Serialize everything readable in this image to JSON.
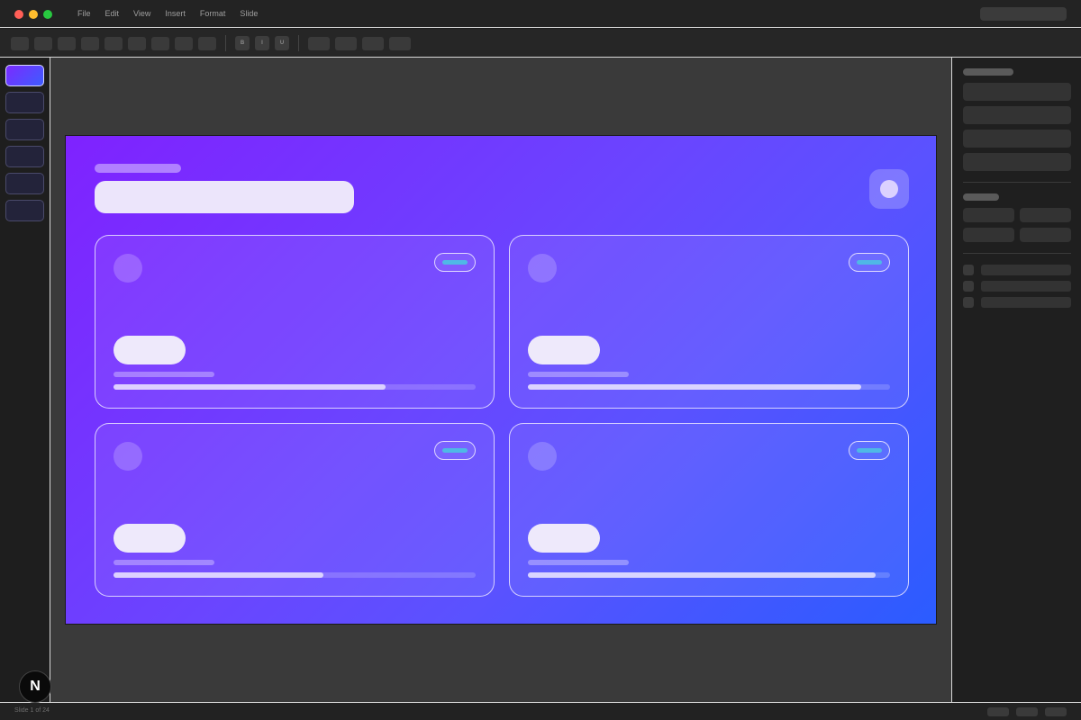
{
  "menu": {
    "items": [
      "File",
      "Edit",
      "View",
      "Insert",
      "Format",
      "Slide"
    ]
  },
  "toolbar": {
    "format_buttons": [
      "B",
      "I",
      "U"
    ]
  },
  "slides": {
    "count": 6,
    "active_index": 0
  },
  "slide": {
    "cards": [
      {
        "progress": 0.75
      },
      {
        "progress": 0.92
      },
      {
        "progress": 0.58
      },
      {
        "progress": 0.96
      }
    ]
  },
  "status": {
    "text": "Slide 1 of 24"
  },
  "logo": {
    "letter": "N"
  },
  "colors": {
    "accent": "#7b2bff",
    "slide_gradient_end": "#2b5cff",
    "tag": "#4fb8e6"
  }
}
